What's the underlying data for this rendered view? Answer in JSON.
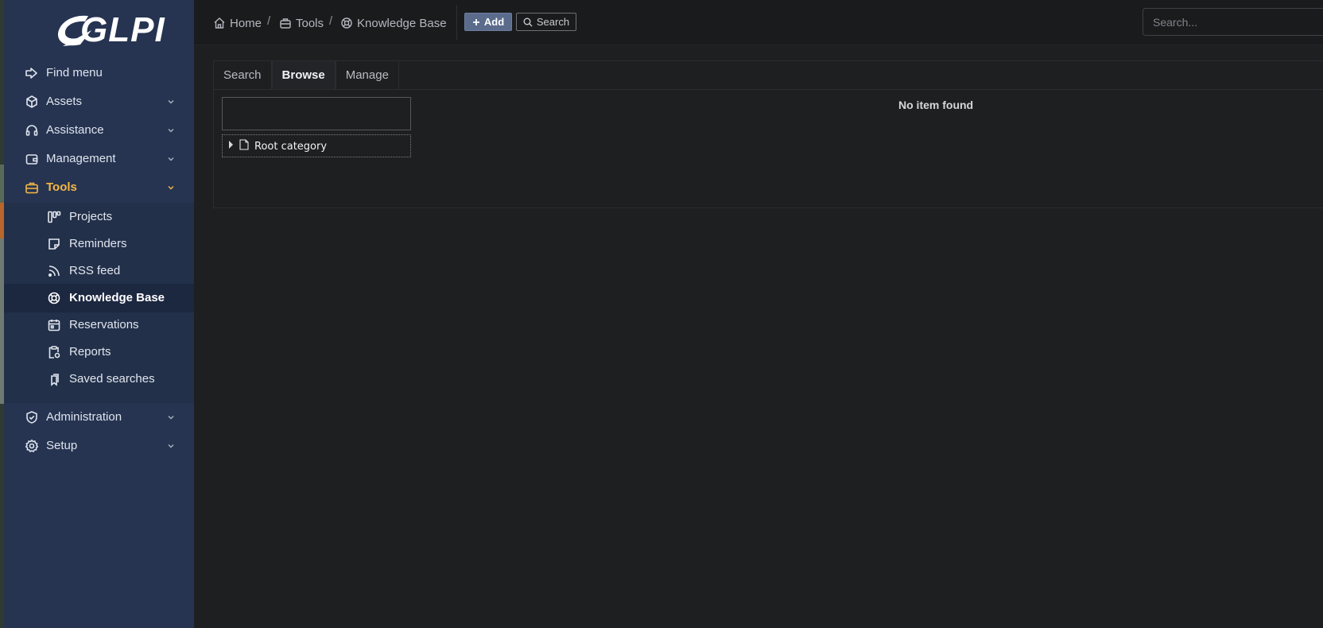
{
  "app": {
    "logo_text": "GLPI"
  },
  "sidebar": {
    "items": [
      {
        "label": "Find menu",
        "icon": "arrow-right-in-icon"
      },
      {
        "label": "Assets",
        "icon": "cube-icon"
      },
      {
        "label": "Assistance",
        "icon": "headset-icon"
      },
      {
        "label": "Management",
        "icon": "wallet-icon"
      },
      {
        "label": "Tools",
        "icon": "briefcase-icon",
        "active": true
      },
      {
        "label": "Administration",
        "icon": "shield-check-icon"
      },
      {
        "label": "Setup",
        "icon": "gear-icon"
      }
    ],
    "tools_subitems": [
      {
        "label": "Projects",
        "icon": "columns-icon"
      },
      {
        "label": "Reminders",
        "icon": "note-icon"
      },
      {
        "label": "RSS feed",
        "icon": "rss-icon"
      },
      {
        "label": "Knowledge Base",
        "icon": "lifebuoy-icon",
        "current": true
      },
      {
        "label": "Reservations",
        "icon": "calendar-icon"
      },
      {
        "label": "Reports",
        "icon": "report-icon"
      },
      {
        "label": "Saved searches",
        "icon": "bookmarks-icon"
      }
    ],
    "active_color": "#f5b744"
  },
  "topbar": {
    "breadcrumb": [
      "Home",
      "Tools",
      "Knowledge Base"
    ],
    "separator": "/",
    "add_label": "Add",
    "search_label": "Search",
    "global_search_placeholder": "Search..."
  },
  "tabs": [
    {
      "label": "Search"
    },
    {
      "label": "Browse",
      "active": true
    },
    {
      "label": "Manage"
    }
  ],
  "tree": {
    "root_label": "Root category"
  },
  "results": {
    "empty_message": "No item found"
  }
}
